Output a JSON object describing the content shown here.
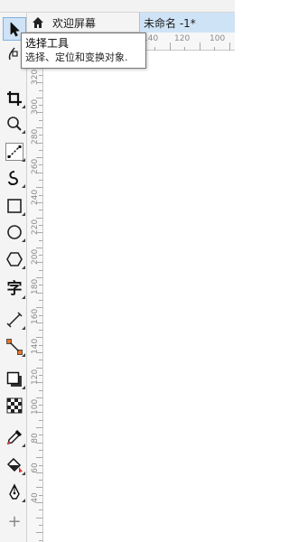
{
  "tabs": {
    "home_label": "欢迎屏幕",
    "document_label": "未命名 -1*"
  },
  "tooltip": {
    "title": "选择工具",
    "description": "选择、定位和变换对象."
  },
  "toolbox": {
    "selected_tool": "pick-tool",
    "tools": [
      "pick-tool",
      "shape-tool",
      "crop-tool",
      "zoom-tool",
      "freehand-tool",
      "artistic-media-tool",
      "rectangle-tool",
      "ellipse-tool",
      "polygon-tool",
      "text-tool",
      "parallel-dimension-tool",
      "connector-tool",
      "drop-shadow-tool",
      "transparency-tool",
      "eyedropper-tool",
      "interactive-fill-tool",
      "smart-fill-tool",
      "quick-customize-button"
    ],
    "text_tool_glyph": "字",
    "add_glyph": "+"
  },
  "hruler": {
    "labels": [
      "140",
      "120",
      "100"
    ]
  },
  "vruler": {
    "labels": [
      "320",
      "300",
      "280",
      "260",
      "240",
      "220",
      "200",
      "180",
      "160",
      "140",
      "120",
      "100",
      "80",
      "60",
      "40"
    ]
  },
  "colors": {
    "accent": "#cfe3f7",
    "accent_border": "#7fb0e0"
  }
}
